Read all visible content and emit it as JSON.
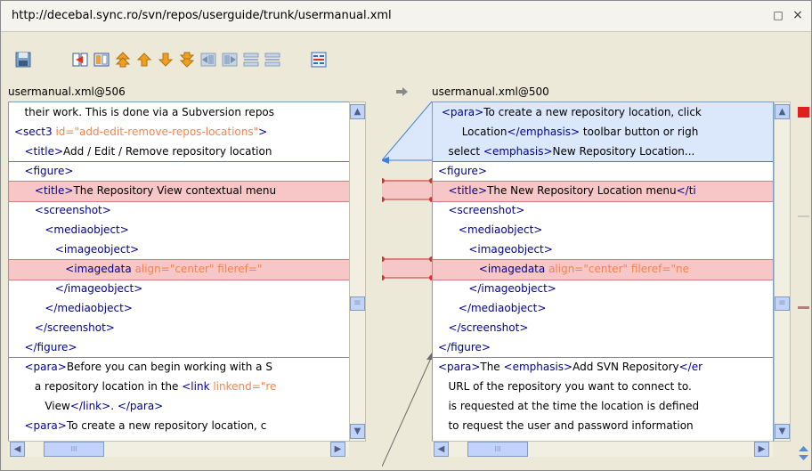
{
  "window": {
    "title": "http://decebal.sync.ro/svn/repos/userguide/trunk/usermanual.xml"
  },
  "titlebar": {
    "restore_glyph": "□",
    "close_glyph": "×"
  },
  "toolbar": {
    "icons": [
      "save-icon",
      "copy-all-left-icon",
      "copy-change-left-icon",
      "first-change-icon",
      "previous-change-icon",
      "next-change-icon",
      "last-change-icon",
      "copy-left-icon",
      "copy-right-icon",
      "merge-all-icon",
      "ignore-whitespace-icon",
      "diff-options-icon"
    ]
  },
  "left": {
    "label": "usermanual.xml@506",
    "lines": [
      [
        {
          "t": "   their work. This is done via a Subversion repos",
          "c": "text"
        }
      ],
      [
        {
          "t": "<sect3 ",
          "c": "tag"
        },
        {
          "t": "id=",
          "c": "attr"
        },
        {
          "t": "\"add-edit-remove-repos-locations\"",
          "c": "val"
        },
        {
          "t": ">",
          "c": "tag"
        }
      ],
      [
        {
          "t": "   <title>",
          "c": "tag"
        },
        {
          "t": "Add / Edit / Remove repository location",
          "c": "text"
        }
      ],
      [
        {
          "t": "   <figure>",
          "c": "tag"
        }
      ],
      [
        {
          "t": "      <title>",
          "c": "tag"
        },
        {
          "t": "The Repository View contextual menu",
          "c": "text"
        }
      ],
      [
        {
          "t": "      <screenshot>",
          "c": "tag"
        }
      ],
      [
        {
          "t": "         <mediaobject>",
          "c": "tag"
        }
      ],
      [
        {
          "t": "            <imageobject>",
          "c": "tag"
        }
      ],
      [
        {
          "t": "               <imagedata ",
          "c": "tag"
        },
        {
          "t": "align=",
          "c": "attr"
        },
        {
          "t": "\"center\" ",
          "c": "val"
        },
        {
          "t": "fileref=",
          "c": "attr"
        },
        {
          "t": "\"",
          "c": "val"
        }
      ],
      [
        {
          "t": "            </imageobject>",
          "c": "tag"
        }
      ],
      [
        {
          "t": "         </mediaobject>",
          "c": "tag"
        }
      ],
      [
        {
          "t": "      </screenshot>",
          "c": "tag"
        }
      ],
      [
        {
          "t": "   </figure>",
          "c": "tag"
        }
      ],
      [
        {
          "t": "   <para>",
          "c": "tag"
        },
        {
          "t": "Before you can begin working with a S",
          "c": "text"
        }
      ],
      [
        {
          "t": "      a repository location in the ",
          "c": "text"
        },
        {
          "t": "<link ",
          "c": "tag"
        },
        {
          "t": "linkend=",
          "c": "attr"
        },
        {
          "t": "\"re",
          "c": "val"
        }
      ],
      [
        {
          "t": "         View",
          "c": "text"
        },
        {
          "t": "</link>",
          "c": "tag"
        },
        {
          "t": ". ",
          "c": "text"
        },
        {
          "t": "</para>",
          "c": "tag"
        }
      ],
      [
        {
          "t": "   <para>",
          "c": "tag"
        },
        {
          "t": "To create a new repository location, c",
          "c": "text"
        }
      ]
    ]
  },
  "right": {
    "label": "usermanual.xml@500",
    "lines": [
      [
        {
          "t": " <para>",
          "c": "tag"
        },
        {
          "t": "To create a new repository location, click",
          "c": "text"
        }
      ],
      [
        {
          "t": "       Location",
          "c": "text"
        },
        {
          "t": "</emphasis>",
          "c": "tag"
        },
        {
          "t": " toolbar button or righ",
          "c": "text"
        }
      ],
      [
        {
          "t": "   select ",
          "c": "text"
        },
        {
          "t": "<emphasis>",
          "c": "tag"
        },
        {
          "t": "New Repository Location...",
          "c": "text"
        }
      ],
      [
        {
          "t": "<figure>",
          "c": "tag"
        }
      ],
      [
        {
          "t": "   <title>",
          "c": "tag"
        },
        {
          "t": "The New Repository Location menu",
          "c": "text"
        },
        {
          "t": "</ti",
          "c": "tag"
        }
      ],
      [
        {
          "t": "   <screenshot>",
          "c": "tag"
        }
      ],
      [
        {
          "t": "      <mediaobject>",
          "c": "tag"
        }
      ],
      [
        {
          "t": "         <imageobject>",
          "c": "tag"
        }
      ],
      [
        {
          "t": "            <imagedata ",
          "c": "tag"
        },
        {
          "t": "align=",
          "c": "attr"
        },
        {
          "t": "\"center\" ",
          "c": "val"
        },
        {
          "t": "fileref=",
          "c": "attr"
        },
        {
          "t": "\"ne",
          "c": "val"
        }
      ],
      [
        {
          "t": "         </imageobject>",
          "c": "tag"
        }
      ],
      [
        {
          "t": "      </mediaobject>",
          "c": "tag"
        }
      ],
      [
        {
          "t": "   </screenshot>",
          "c": "tag"
        }
      ],
      [
        {
          "t": "</figure>",
          "c": "tag"
        }
      ],
      [
        {
          "t": "<para>",
          "c": "tag"
        },
        {
          "t": "The ",
          "c": "text"
        },
        {
          "t": "<emphasis>",
          "c": "tag"
        },
        {
          "t": "Add SVN Repository",
          "c": "text"
        },
        {
          "t": "</er",
          "c": "tag"
        }
      ],
      [
        {
          "t": "   URL of the repository you want to connect to.",
          "c": "text"
        }
      ],
      [
        {
          "t": "   is requested at the time the location is defined",
          "c": "text"
        }
      ],
      [
        {
          "t": "   to request the user and password information",
          "c": "text"
        }
      ]
    ]
  },
  "scroll": {
    "h_thumb_glyph": "III",
    "v_thumb_glyph": "≡"
  },
  "colors": {
    "changed_bg": "#f7c6c6",
    "inserted_bg": "#dbe8fb",
    "separator": "#3c7fe0",
    "diff_marker": "#cc3333"
  }
}
